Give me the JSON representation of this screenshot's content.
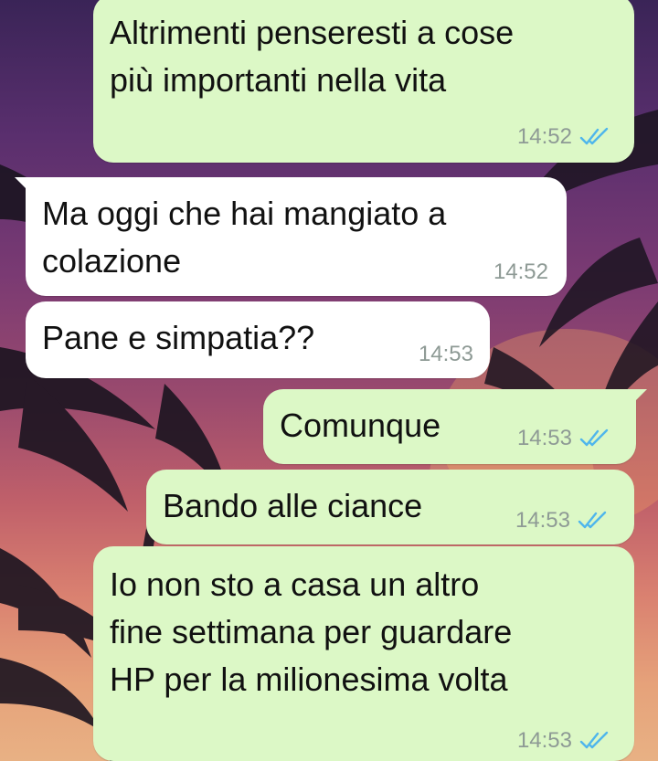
{
  "colors": {
    "outgoing_bubble": "#dcf8c6",
    "incoming_bubble": "#ffffff",
    "read_ticks": "#4fb6ec",
    "timestamp": "#8e9a95"
  },
  "messages": [
    {
      "direction": "outgoing",
      "text": "Altrimenti penseresti a cose\npiù importanti nella vita",
      "time": "14:52",
      "status_icon": "double-check-read-icon"
    },
    {
      "direction": "incoming",
      "text": "Ma oggi che hai mangiato a\ncolazione",
      "time": "14:52"
    },
    {
      "direction": "incoming",
      "text": "Pane e simpatia??",
      "time": "14:53"
    },
    {
      "direction": "outgoing",
      "text": "Comunque",
      "time": "14:53",
      "status_icon": "double-check-read-icon"
    },
    {
      "direction": "outgoing",
      "text": "Bando alle ciance",
      "time": "14:53",
      "status_icon": "double-check-read-icon"
    },
    {
      "direction": "outgoing",
      "text": "Io non sto a casa un altro\nfine settimana per guardare\nHP per la milionesima volta",
      "time": "14:53",
      "status_icon": "double-check-read-icon"
    }
  ]
}
